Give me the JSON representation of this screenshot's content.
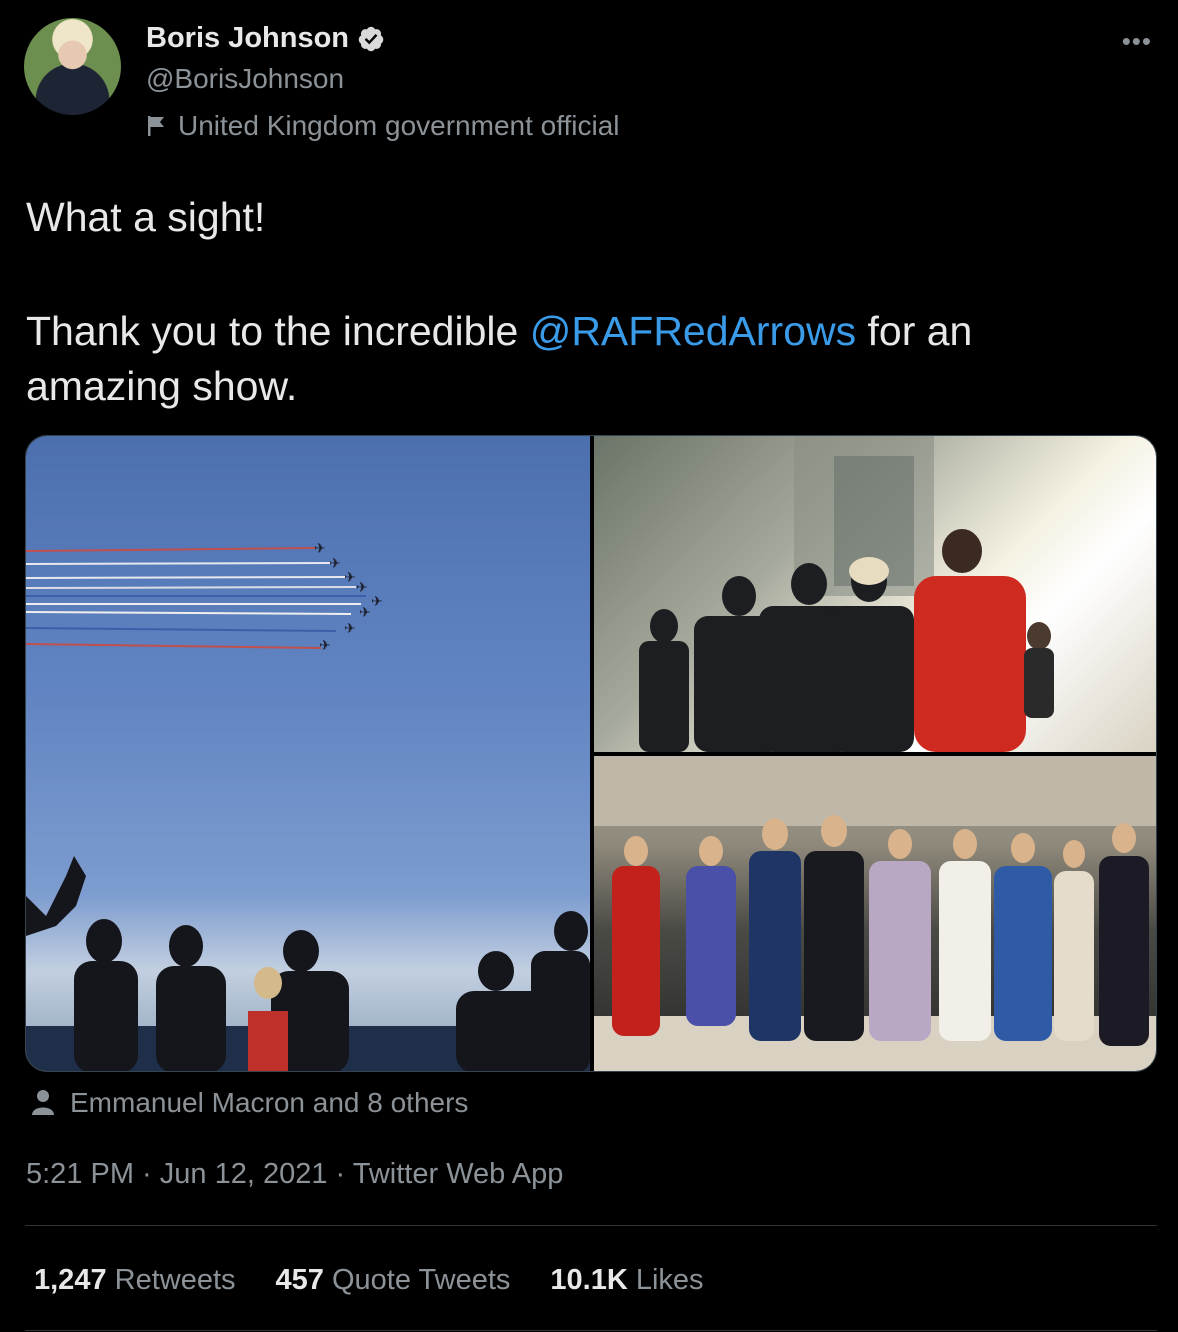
{
  "author": {
    "name": "Boris Johnson",
    "handle": "@BorisJohnson",
    "label": "United Kingdom government official",
    "verified_icon": "verified-badge-icon"
  },
  "tweet": {
    "line1": "What a sight!",
    "line2_pre": "Thank you to the incredible ",
    "mention": "@RAFRedArrows",
    "line2_post": " for an",
    "line3": "amazing show."
  },
  "media": {
    "tagged": "Emmanuel Macron and 8 others"
  },
  "meta": {
    "time": "5:21 PM",
    "sep1": " · ",
    "date": "Jun 12, 2021",
    "sep2": " · ",
    "source": "Twitter Web App"
  },
  "stats": {
    "retweets_count": "1,247",
    "retweets_label": "Retweets",
    "quotes_count": "457",
    "quotes_label": "Quote Tweets",
    "likes_count": "10.1K",
    "likes_label": "Likes"
  },
  "colors": {
    "background": "#000000",
    "text": "#e8e8e8",
    "secondary": "#8b9298",
    "link": "#3a9be9"
  }
}
